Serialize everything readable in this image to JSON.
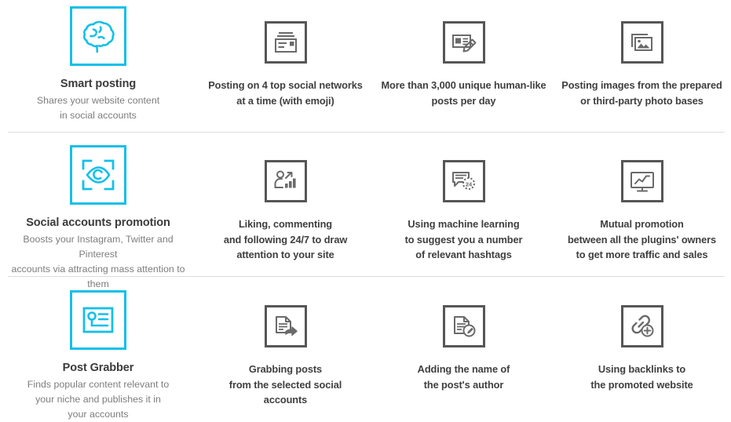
{
  "theme": {
    "accent_color": "#13c0e9",
    "icon_border_color": "#565656",
    "title_color": "#3b3b3b",
    "desc_color": "#7d7d7d",
    "divider_color": "#dcdcdc",
    "background": "#ffffff"
  },
  "rows": [
    {
      "featured": {
        "icon": "brain-icon",
        "title": "Smart posting",
        "desc_lines": [
          "Shares your website content",
          "in social accounts"
        ]
      },
      "cells": [
        {
          "icon": "newspaper-card-icon",
          "text_lines": [
            "Posting on 4 top social networks",
            "at a time (with emoji)"
          ]
        },
        {
          "icon": "article-pencil-icon",
          "text_lines": [
            "More than 3,000 unique human-like",
            "posts per day"
          ]
        },
        {
          "icon": "photo-stack-icon",
          "text_lines": [
            "Posting images from the prepared",
            "or third-party photo bases"
          ]
        }
      ]
    },
    {
      "featured": {
        "icon": "eye-focus-icon",
        "title": "Social accounts promotion",
        "desc_lines": [
          "Boosts your Instagram, Twitter and Pinterest",
          "accounts via attracting mass attention to them"
        ]
      },
      "cells": [
        {
          "icon": "person-growth-chart-icon",
          "text_lines": [
            "Liking, commenting",
            "and following 24/7 to draw",
            "attention to your site"
          ]
        },
        {
          "icon": "chat-24-clock-icon",
          "text_lines": [
            "Using machine learning",
            "to suggest you a number",
            "of relevant hashtags"
          ]
        },
        {
          "icon": "monitor-trend-icon",
          "text_lines": [
            "Mutual promotion",
            "between all the plugins' owners",
            "to get more traffic and sales"
          ]
        }
      ]
    },
    {
      "featured": {
        "icon": "document-search-icon",
        "title": "Post Grabber",
        "desc_lines": [
          "Finds popular content relevant to",
          "your niche and publishes it in",
          "your accounts"
        ]
      },
      "cells": [
        {
          "icon": "document-share-icon",
          "text_lines": [
            "Grabbing posts",
            "from the selected social",
            "accounts"
          ]
        },
        {
          "icon": "document-pencil-icon",
          "text_lines": [
            "Adding the name of",
            "the post's author"
          ]
        },
        {
          "icon": "link-plus-icon",
          "text_lines": [
            "Using backlinks to",
            "the promoted website"
          ]
        }
      ]
    }
  ]
}
